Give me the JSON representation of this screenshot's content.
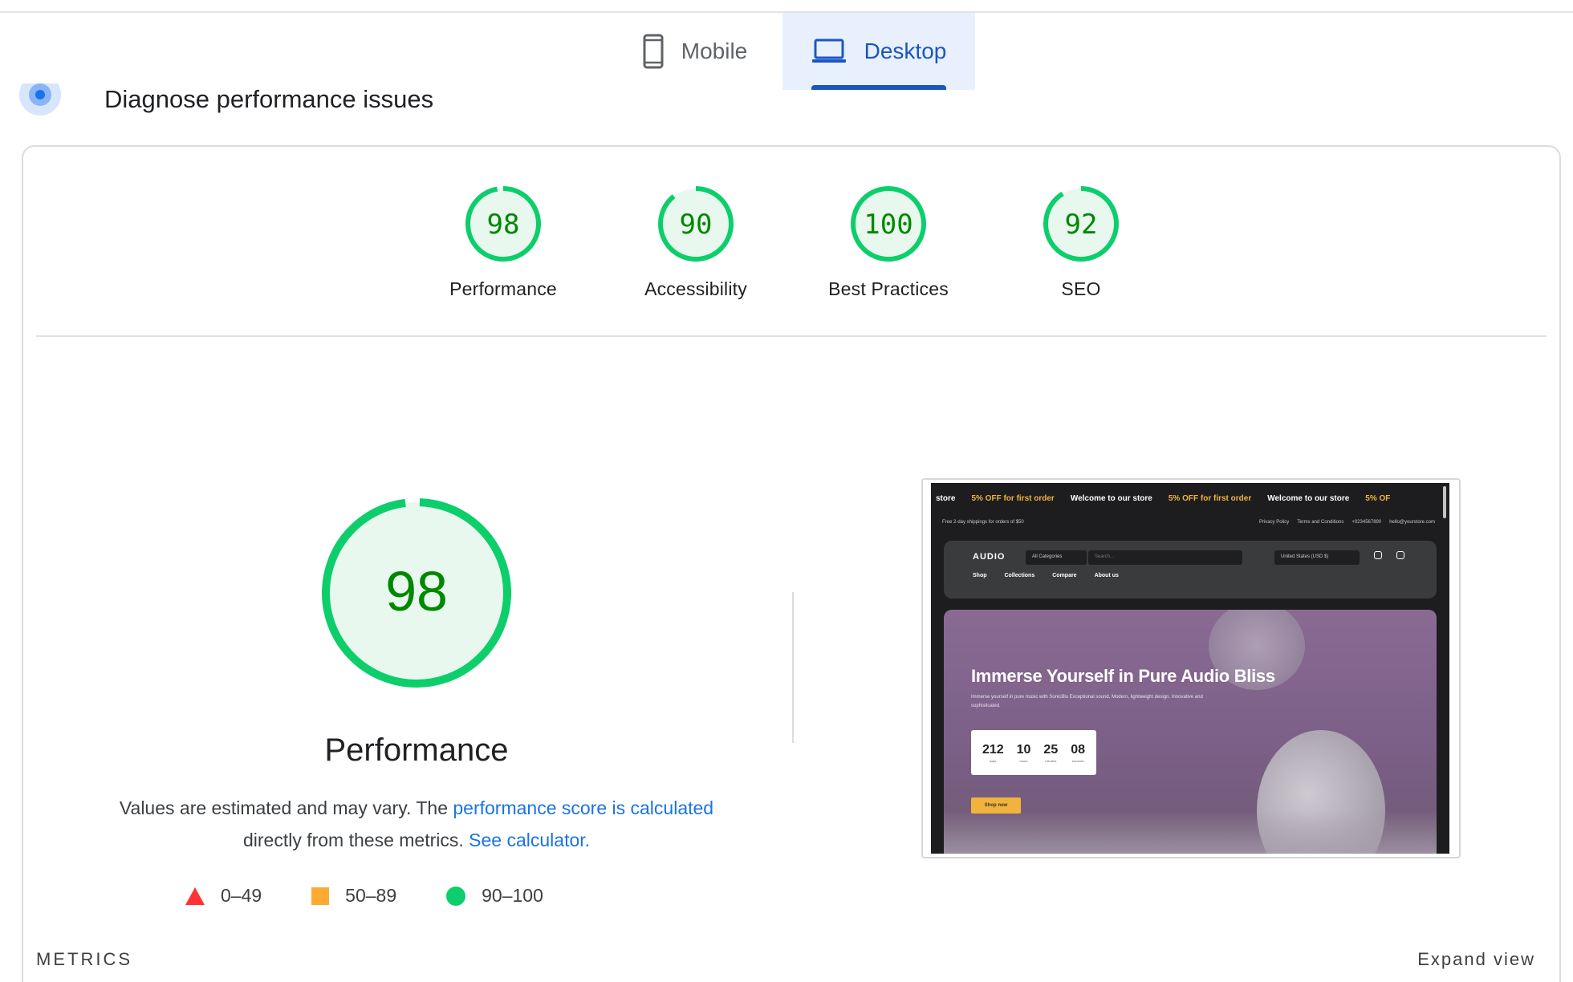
{
  "tabs": {
    "mobile_label": "Mobile",
    "desktop_label": "Desktop",
    "active": "desktop"
  },
  "header": {
    "title": "Diagnose performance issues"
  },
  "categories": [
    {
      "label": "Performance",
      "score": "98",
      "value": 98
    },
    {
      "label": "Accessibility",
      "score": "90",
      "value": 90
    },
    {
      "label": "Best Practices",
      "score": "100",
      "value": 100
    },
    {
      "label": "SEO",
      "score": "92",
      "value": 92
    }
  ],
  "main_score": {
    "score": "98",
    "value": 98,
    "title": "Performance"
  },
  "note": {
    "text1": "Values are estimated and may vary. The ",
    "link1": "performance score is calculated",
    "text2": " directly from these metrics. ",
    "link2": "See calculator."
  },
  "legend": [
    {
      "label": "0–49",
      "shape": "triangle",
      "color": "#ff3333"
    },
    {
      "label": "50–89",
      "shape": "square",
      "color": "#ffaa33"
    },
    {
      "label": "90–100",
      "shape": "circle",
      "color": "#0cce6b"
    }
  ],
  "metrics": {
    "heading": "METRICS",
    "expand_label": "Expand view"
  },
  "colors": {
    "pass": "#0cce6b",
    "pass_text": "#008800",
    "pass_fill": "#e8f8ee",
    "accent": "#1a73e8",
    "tab_active": "#1a56c4"
  },
  "preview": {
    "marquee": [
      "store",
      "5% OFF for first order",
      "Welcome to our store",
      "5% OFF for first order",
      "Welcome to our store",
      "5% OF"
    ],
    "subbar_left": "Free 2-day shippings for orders of $50",
    "subbar_right": [
      "Privacy Policy",
      "Terms and Conditions",
      "+0234567890",
      "hello@yourstore.com"
    ],
    "logo": "AUDIO",
    "category_select": "All Categories",
    "search_placeholder": "Search...",
    "currency": "United States (USD $)",
    "nav": [
      "Shop",
      "Collections",
      "Compare",
      "About us"
    ],
    "hero_title": "Immerse Yourself in Pure Audio Bliss",
    "hero_sub": "Immerse yourself in pure music with SonicBlu Exceptional sound, Modern, lightweight design. Innovative and sophisticated.",
    "countdown": [
      {
        "n": "212",
        "l": "days"
      },
      {
        "n": "10",
        "l": "hours"
      },
      {
        "n": "25",
        "l": "minutes"
      },
      {
        "n": "08",
        "l": "seconds"
      }
    ],
    "cta": "Shop now"
  }
}
